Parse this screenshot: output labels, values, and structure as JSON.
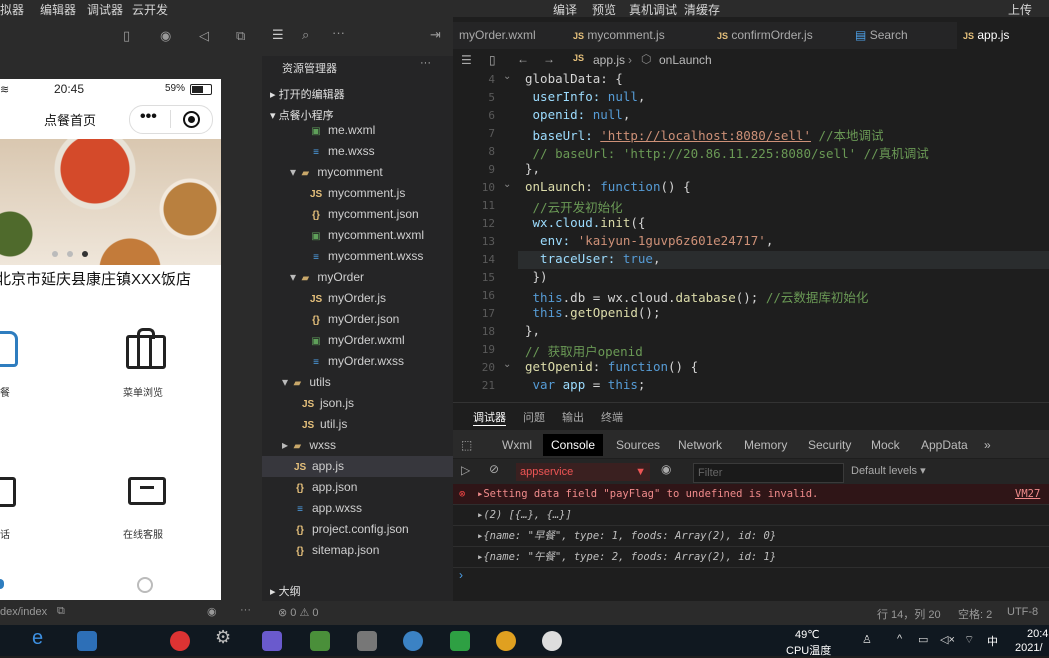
{
  "menu": [
    "拟器",
    "编辑器",
    "调试器",
    "云开发",
    "编译",
    "预览",
    "真机调试",
    "清缓存",
    "上传"
  ],
  "sim": {
    "time": "20:45",
    "battery": "59%",
    "nav_title": "点餐首页",
    "shop_name": "北京市延庆县康庄镇XXX饭店",
    "grid_labels": [
      "餐",
      "菜单浏览",
      "话",
      "在线客服"
    ],
    "page_path": "dex/index"
  },
  "explorer": {
    "title": "资源管理器",
    "open_editors": "打开的编辑器",
    "project": "点餐小程序",
    "outline": "大纲",
    "files": [
      {
        "name": "me.wxml",
        "type": "wxml",
        "depth": 2
      },
      {
        "name": "me.wxss",
        "type": "wxss",
        "depth": 2
      },
      {
        "name": "mycomment",
        "type": "folder",
        "depth": 1
      },
      {
        "name": "mycomment.js",
        "type": "js",
        "depth": 2
      },
      {
        "name": "mycomment.json",
        "type": "json",
        "depth": 2
      },
      {
        "name": "mycomment.wxml",
        "type": "wxml",
        "depth": 2
      },
      {
        "name": "mycomment.wxss",
        "type": "wxss",
        "depth": 2
      },
      {
        "name": "myOrder",
        "type": "folder",
        "depth": 1
      },
      {
        "name": "myOrder.js",
        "type": "js",
        "depth": 2
      },
      {
        "name": "myOrder.json",
        "type": "json",
        "depth": 2
      },
      {
        "name": "myOrder.wxml",
        "type": "wxml",
        "depth": 2
      },
      {
        "name": "myOrder.wxss",
        "type": "wxss",
        "depth": 2
      },
      {
        "name": "utils",
        "type": "folder",
        "depth": 0
      },
      {
        "name": "json.js",
        "type": "js",
        "depth": 1
      },
      {
        "name": "util.js",
        "type": "js",
        "depth": 1
      },
      {
        "name": "wxss",
        "type": "folder",
        "depth": 0
      },
      {
        "name": "app.js",
        "type": "js",
        "depth": 0,
        "selected": true
      },
      {
        "name": "app.json",
        "type": "json",
        "depth": 0
      },
      {
        "name": "app.wxss",
        "type": "wxss",
        "depth": 0
      },
      {
        "name": "project.config.json",
        "type": "json",
        "depth": 0
      },
      {
        "name": "sitemap.json",
        "type": "json",
        "depth": 0
      }
    ]
  },
  "tabs": [
    "myOrder.wxml",
    "mycomment.js",
    "confirmOrder.js",
    "Search",
    "app.js"
  ],
  "breadcrumb": {
    "file": "app.js",
    "symbol": "onLaunch"
  },
  "code": {
    "line_numbers": [
      "4",
      "5",
      "6",
      "7",
      "8",
      "9",
      "10",
      "11",
      "12",
      "13",
      "14",
      "15",
      "16",
      "17",
      "18",
      "19",
      "20",
      "21"
    ],
    "l4": "globalData: {",
    "l5a": " userInfo: ",
    "l5b": "null",
    "l5c": ",",
    "l6a": " openid: ",
    "l6b": "null",
    "l6c": ",",
    "l7a": " baseUrl: ",
    "l7b": "'http://localhost:8080/sell'",
    "l7c": " //本地调试",
    "l8": " // baseUrl: 'http://20.86.11.225:8080/sell' //真机调试",
    "l9": "},",
    "l10a": "onLaunch",
    "l10b": ": ",
    "l10c": "function",
    "l10d": "() {",
    "l11": " //云开发初始化",
    "l12a": " wx.cloud.",
    "l12b": "init",
    "l12c": "({",
    "l13a": "  env: ",
    "l13b": "'kaiyun-1guvp6z601e24717'",
    "l13c": ",",
    "l14a": "  traceUser: ",
    "l14b": "true",
    "l14c": ",",
    "l15": " })",
    "l16a": " this",
    "l16b": ".db = wx.cloud.",
    "l16c": "database",
    "l16d": "(); ",
    "l16e": "//云数据库初始化",
    "l17a": " this",
    "l17b": ".",
    "l17c": "getOpenid",
    "l17d": "();",
    "l18": "},",
    "l19": "// 获取用户openid",
    "l20a": "getOpenid",
    "l20b": ": ",
    "l20c": "function",
    "l20d": "() {",
    "l21a": " var ",
    "l21b": "app",
    "l21c": " = ",
    "l21d": "this",
    "l21e": ";"
  },
  "panel": {
    "tabs": [
      "调试器",
      "问题",
      "输出",
      "终端"
    ],
    "devtools": [
      "Wxml",
      "Console",
      "Sources",
      "Network",
      "Memory",
      "Security",
      "Mock",
      "AppData"
    ],
    "context": "appservice",
    "filter_placeholder": "Filter",
    "levels": "Default levels",
    "logs": [
      {
        "text": "▸Setting data field \"payFlag\" to undefined is invalid.",
        "src": "VM27",
        "kind": "err"
      },
      {
        "text": "▸(2) [{…}, {…}]",
        "src": "",
        "kind": "info"
      },
      {
        "text": "▸{name: \"早餐\", type: 1, foods: Array(2), id: 0}",
        "src": "",
        "kind": "info"
      },
      {
        "text": "▸{name: \"午餐\", type: 2, foods: Array(2), id: 1}",
        "src": "",
        "kind": "info"
      }
    ]
  },
  "status": {
    "errors": "0",
    "warnings": "0",
    "cursor": "行 14，列 20",
    "indent": "空格: 2",
    "encoding": "UTF-8"
  },
  "taskbar": {
    "temp": "49℃",
    "temp_label": "CPU温度",
    "lang": "中",
    "time": "20:4",
    "date": "2021/"
  }
}
